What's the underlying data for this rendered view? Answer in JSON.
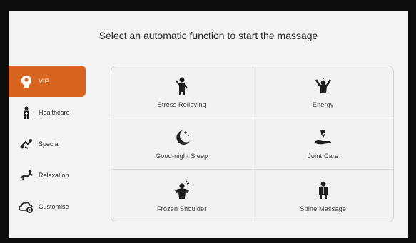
{
  "header": {
    "title": "Select an automatic function to start the massage"
  },
  "sidebar": {
    "items": [
      {
        "label": "VIP",
        "icon": "vip-head-icon",
        "active": true
      },
      {
        "label": "Healthcare",
        "icon": "healthcare-person-icon",
        "active": false
      },
      {
        "label": "Special",
        "icon": "special-icon",
        "active": false
      },
      {
        "label": "Relaxation",
        "icon": "relaxation-icon",
        "active": false
      },
      {
        "label": "Customise",
        "icon": "cloud-settings-icon",
        "active": false
      }
    ]
  },
  "functions": [
    {
      "label": "Stress Relieving",
      "icon": "stress-relieving-icon"
    },
    {
      "label": "Energy",
      "icon": "energy-icon"
    },
    {
      "label": "Good-night Sleep",
      "icon": "moon-icon"
    },
    {
      "label": "Joint Care",
      "icon": "joint-care-icon"
    },
    {
      "label": "Frozen Shoulder",
      "icon": "frozen-shoulder-icon"
    },
    {
      "label": "Spine Massage",
      "icon": "spine-massage-icon"
    }
  ],
  "colors": {
    "accent": "#d76520",
    "background": "#f3f3f3",
    "text": "#2b2b2b"
  }
}
